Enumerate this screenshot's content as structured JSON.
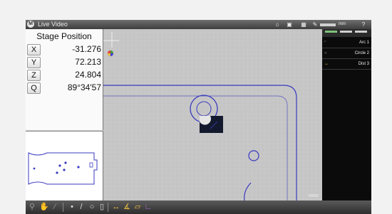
{
  "window": {
    "title": "Live Video",
    "zoom_label": "mm"
  },
  "stage": {
    "title": "Stage Position",
    "axes": [
      {
        "label": "X",
        "value": "-31.276"
      },
      {
        "label": "Y",
        "value": "72.213"
      },
      {
        "label": "Z",
        "value": "24.804"
      },
      {
        "label": "Q",
        "value": "89°34'57"
      }
    ]
  },
  "features": [
    {
      "icon": "arc-icon",
      "label": "Arc 1"
    },
    {
      "icon": "circle-icon",
      "label": "Circle 2"
    },
    {
      "icon": "distance-icon",
      "label": "Dist 3"
    }
  ],
  "toolbar": {
    "tools": [
      "magnify-icon",
      "hand-icon",
      "pen-icon",
      "point-icon",
      "line-icon",
      "circle-icon",
      "slot-icon",
      "distance-icon",
      "angle-icon",
      "parallelogram-icon",
      "perpendicular-icon"
    ]
  },
  "colors": {
    "accent": "#f0c040",
    "geometry": "#3a3ac0",
    "panel": "#0b0b0b"
  }
}
